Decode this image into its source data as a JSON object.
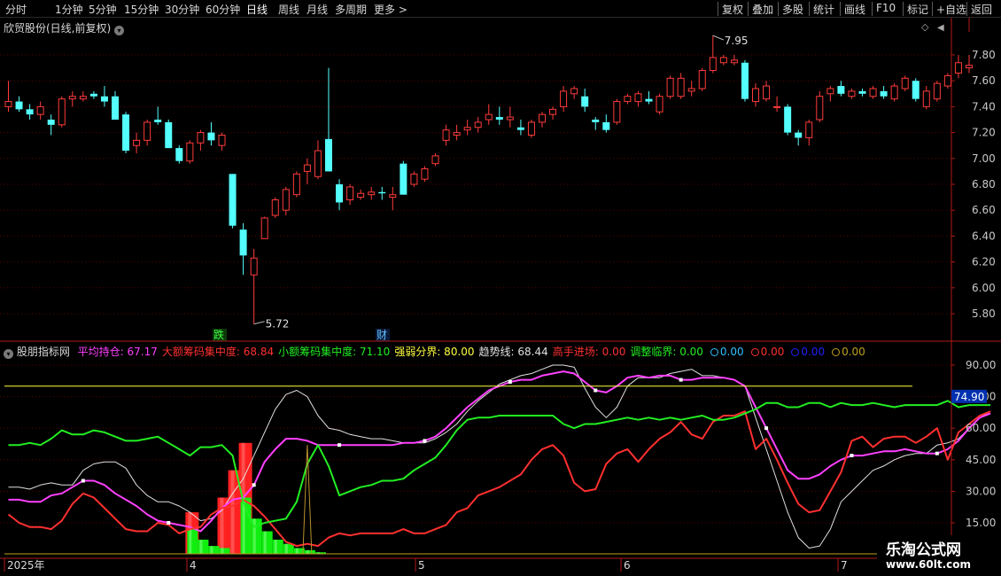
{
  "toolbar": {
    "tabs": [
      "分时",
      "1分钟",
      "5分钟",
      "15分钟",
      "30分钟",
      "60分钟",
      "日线",
      "周线",
      "月线",
      "多周期",
      "更多 >"
    ],
    "active_tab": "日线",
    "right_buttons": [
      "复权",
      "叠加",
      "多股",
      "统计",
      "画线",
      "F10",
      "标记",
      "+自选",
      "返回"
    ]
  },
  "stock_title": "欣贸股份(日线,前复权)",
  "markers": {
    "max_label": "7.95",
    "min_label": "5.72",
    "event_fall": "跌",
    "event_fin": "财"
  },
  "indicator": {
    "name": "股朋指标网",
    "legend": [
      {
        "label": "平均持仓: 67.17",
        "color": "#ff40ff"
      },
      {
        "label": "大额筹码集中度: 68.84",
        "color": "#ff3030"
      },
      {
        "label": "小额筹码集中度: 71.10",
        "color": "#22ee22"
      },
      {
        "label": "强弱分界: 80.00",
        "color": "#ffff40"
      },
      {
        "label": "趋势线: 68.44",
        "color": "#e0e0e0"
      },
      {
        "label": "高手进场: 0.00",
        "color": "#ff3030"
      },
      {
        "label": "调整临界: 0.00",
        "color": "#22ee22"
      },
      {
        "label": "0.00",
        "color": "#30c0ff"
      },
      {
        "label": "0.00",
        "color": "#ff3030"
      },
      {
        "label": "0.00",
        "color": "#2020ff"
      },
      {
        "label": "0.00",
        "color": "#bfa020"
      }
    ],
    "cursor_value": "74.90"
  },
  "price_axis": [
    "7.80",
    "7.60",
    "7.40",
    "7.20",
    "7.00",
    "6.80",
    "6.60",
    "6.40",
    "6.20",
    "6.00",
    "5.80"
  ],
  "ind_axis": [
    "90.00",
    "75.00",
    "60.00",
    "45.00",
    "30.00",
    "15.00"
  ],
  "date_axis": [
    "2025年",
    "4",
    "5",
    "6",
    "7"
  ],
  "watermark": {
    "line1": "乐淘公式网",
    "line2": "www.60lt.com"
  },
  "colors": {
    "up": "#ff3b3b",
    "down": "#54ffff",
    "grid": "#5a0000",
    "axis": "#b01818"
  },
  "chart_data": [
    {
      "type": "candlestick",
      "title": "欣贸股份(日线,前复权)",
      "ylim": [
        5.7,
        7.95
      ],
      "annotations": [
        {
          "x": 47,
          "text": "7.95"
        },
        {
          "x": 19,
          "text": "5.72"
        }
      ],
      "ohlc": [
        [
          7.4,
          7.6,
          7.36,
          7.44
        ],
        [
          7.44,
          7.48,
          7.36,
          7.38
        ],
        [
          7.38,
          7.42,
          7.3,
          7.34
        ],
        [
          7.34,
          7.44,
          7.3,
          7.4
        ],
        [
          7.3,
          7.34,
          7.18,
          7.26
        ],
        [
          7.26,
          7.48,
          7.24,
          7.46
        ],
        [
          7.46,
          7.52,
          7.4,
          7.48
        ],
        [
          7.46,
          7.52,
          7.44,
          7.48
        ],
        [
          7.5,
          7.52,
          7.46,
          7.48
        ],
        [
          7.48,
          7.56,
          7.4,
          7.44
        ],
        [
          7.48,
          7.52,
          7.3,
          7.3
        ],
        [
          7.34,
          7.36,
          7.04,
          7.06
        ],
        [
          7.1,
          7.2,
          7.04,
          7.14
        ],
        [
          7.14,
          7.3,
          7.1,
          7.28
        ],
        [
          7.3,
          7.4,
          7.26,
          7.28
        ],
        [
          7.28,
          7.3,
          7.08,
          7.08
        ],
        [
          7.08,
          7.1,
          6.96,
          6.98
        ],
        [
          6.98,
          7.14,
          6.96,
          7.12
        ],
        [
          7.12,
          7.22,
          7.06,
          7.2
        ],
        [
          7.2,
          7.28,
          7.1,
          7.14
        ],
        [
          7.1,
          7.2,
          7.06,
          7.18
        ],
        [
          6.88,
          6.88,
          6.46,
          6.48
        ],
        [
          6.45,
          6.5,
          6.1,
          6.25
        ],
        [
          6.1,
          6.3,
          5.72,
          6.23
        ],
        [
          6.38,
          6.55,
          6.38,
          6.54
        ],
        [
          6.56,
          6.7,
          6.54,
          6.68
        ],
        [
          6.6,
          6.78,
          6.56,
          6.76
        ],
        [
          6.72,
          6.9,
          6.7,
          6.88
        ],
        [
          6.9,
          7.0,
          6.8,
          6.95
        ],
        [
          6.86,
          7.14,
          6.84,
          7.06
        ],
        [
          7.15,
          7.7,
          6.9,
          6.9
        ],
        [
          6.8,
          6.84,
          6.6,
          6.66
        ],
        [
          6.68,
          6.8,
          6.64,
          6.78
        ],
        [
          6.7,
          6.76,
          6.68,
          6.73
        ],
        [
          6.72,
          6.78,
          6.68,
          6.74
        ],
        [
          6.74,
          6.78,
          6.68,
          6.73
        ],
        [
          6.7,
          6.78,
          6.6,
          6.72
        ],
        [
          6.96,
          6.98,
          6.72,
          6.72
        ],
        [
          6.8,
          6.9,
          6.78,
          6.88
        ],
        [
          6.84,
          6.94,
          6.82,
          6.92
        ],
        [
          6.96,
          7.04,
          6.94,
          7.02
        ],
        [
          7.14,
          7.26,
          7.1,
          7.22
        ],
        [
          7.18,
          7.26,
          7.14,
          7.2
        ],
        [
          7.22,
          7.3,
          7.18,
          7.24
        ],
        [
          7.24,
          7.32,
          7.2,
          7.28
        ],
        [
          7.3,
          7.42,
          7.26,
          7.34
        ],
        [
          7.32,
          7.4,
          7.26,
          7.3
        ],
        [
          7.3,
          7.4,
          7.24,
          7.32
        ],
        [
          7.24,
          7.3,
          7.18,
          7.22
        ],
        [
          7.18,
          7.3,
          7.16,
          7.28
        ],
        [
          7.28,
          7.36,
          7.24,
          7.34
        ],
        [
          7.34,
          7.4,
          7.3,
          7.38
        ],
        [
          7.4,
          7.56,
          7.36,
          7.52
        ],
        [
          7.5,
          7.56,
          7.46,
          7.54
        ],
        [
          7.48,
          7.54,
          7.36,
          7.4
        ],
        [
          7.3,
          7.32,
          7.22,
          7.28
        ],
        [
          7.28,
          7.34,
          7.2,
          7.22
        ],
        [
          7.28,
          7.46,
          7.26,
          7.44
        ],
        [
          7.44,
          7.5,
          7.42,
          7.48
        ],
        [
          7.44,
          7.52,
          7.4,
          7.5
        ],
        [
          7.46,
          7.52,
          7.42,
          7.44
        ],
        [
          7.36,
          7.5,
          7.34,
          7.48
        ],
        [
          7.48,
          7.64,
          7.46,
          7.62
        ],
        [
          7.48,
          7.66,
          7.46,
          7.62
        ],
        [
          7.52,
          7.6,
          7.48,
          7.54
        ],
        [
          7.54,
          7.7,
          7.52,
          7.68
        ],
        [
          7.68,
          7.95,
          7.66,
          7.78
        ],
        [
          7.74,
          7.8,
          7.72,
          7.78
        ],
        [
          7.74,
          7.8,
          7.72,
          7.76
        ],
        [
          7.74,
          7.76,
          7.44,
          7.46
        ],
        [
          7.44,
          7.58,
          7.4,
          7.54
        ],
        [
          7.46,
          7.6,
          7.44,
          7.56
        ],
        [
          7.4,
          7.48,
          7.36,
          7.4
        ],
        [
          7.4,
          7.42,
          7.18,
          7.2
        ],
        [
          7.2,
          7.22,
          7.1,
          7.16
        ],
        [
          7.16,
          7.3,
          7.1,
          7.28
        ],
        [
          7.3,
          7.52,
          7.28,
          7.48
        ],
        [
          7.5,
          7.56,
          7.44,
          7.54
        ],
        [
          7.56,
          7.6,
          7.48,
          7.5
        ],
        [
          7.48,
          7.54,
          7.46,
          7.52
        ],
        [
          7.52,
          7.54,
          7.48,
          7.5
        ],
        [
          7.48,
          7.56,
          7.46,
          7.54
        ],
        [
          7.52,
          7.56,
          7.46,
          7.48
        ],
        [
          7.46,
          7.58,
          7.44,
          7.56
        ],
        [
          7.54,
          7.64,
          7.52,
          7.62
        ],
        [
          7.6,
          7.62,
          7.44,
          7.46
        ],
        [
          7.4,
          7.56,
          7.38,
          7.52
        ],
        [
          7.46,
          7.6,
          7.44,
          7.58
        ],
        [
          7.56,
          7.66,
          7.54,
          7.64
        ],
        [
          7.66,
          7.8,
          7.62,
          7.74
        ],
        [
          7.7,
          7.8,
          7.66,
          7.72
        ]
      ]
    },
    {
      "type": "line",
      "title": "股朋指标网",
      "ylim": [
        0,
        100
      ],
      "series": [
        {
          "name": "趋势线",
          "color": "#e0e0e0",
          "values": [
            32,
            32,
            31,
            33,
            34,
            33,
            33,
            40,
            43,
            44,
            44,
            41,
            33,
            28,
            25,
            25,
            23,
            20,
            16,
            17,
            21,
            29,
            36,
            47,
            58,
            69,
            76,
            78,
            75,
            66,
            60,
            59,
            57,
            56,
            55,
            55,
            54,
            53,
            53,
            53,
            55,
            58,
            62,
            68,
            73,
            77,
            81,
            83,
            85,
            86,
            88,
            90,
            90,
            89,
            79,
            70,
            65,
            70,
            80,
            84,
            84,
            84,
            86,
            87,
            88,
            85,
            85,
            84,
            83,
            80,
            65,
            50,
            35,
            20,
            8,
            3,
            4,
            12,
            25,
            30,
            35,
            40,
            42,
            45,
            47,
            48,
            48,
            52,
            53,
            55,
            60,
            65,
            68
          ]
        },
        {
          "name": "平均持仓",
          "color": "#ff40ff",
          "values": [
            26,
            26,
            25,
            25,
            28,
            29,
            32,
            35,
            35,
            33,
            29,
            26,
            23,
            19,
            16,
            15,
            14,
            13,
            11,
            16,
            22,
            26,
            27,
            33,
            44,
            50,
            55,
            55,
            54,
            52,
            52,
            52,
            52,
            52,
            52,
            52,
            52,
            53,
            53,
            54,
            56,
            60,
            65,
            70,
            74,
            78,
            80,
            82,
            83,
            83,
            85,
            86,
            87,
            86,
            82,
            78,
            77,
            80,
            84,
            85,
            84,
            85,
            85,
            83,
            83,
            84,
            84,
            84,
            83,
            80,
            70,
            60,
            50,
            40,
            36,
            36,
            38,
            42,
            45,
            47,
            47,
            48,
            49,
            49,
            50,
            49,
            48,
            48,
            50,
            54,
            60,
            65,
            67
          ]
        },
        {
          "name": "大额筹码集中度",
          "color": "#ff3030",
          "values": [
            19,
            15,
            13,
            13,
            12,
            16,
            24,
            29,
            27,
            22,
            17,
            12,
            11,
            11,
            15,
            14,
            10,
            12,
            13,
            19,
            22,
            23,
            26,
            23,
            18,
            12,
            6,
            4,
            5,
            4,
            8,
            10,
            9,
            10,
            10,
            10,
            10,
            12,
            10,
            10,
            12,
            14,
            20,
            22,
            28,
            30,
            32,
            35,
            38,
            45,
            50,
            52,
            47,
            34,
            30,
            31,
            43,
            48,
            50,
            44,
            50,
            55,
            58,
            63,
            57,
            55,
            63,
            66,
            66,
            68,
            50,
            55,
            45,
            34,
            24,
            20,
            21,
            30,
            39,
            54,
            56,
            51,
            55,
            56,
            56,
            53,
            56,
            60,
            45,
            58,
            62,
            66,
            68
          ]
        },
        {
          "name": "小额筹码集中度",
          "color": "#22ee22",
          "values": [
            52,
            52,
            53,
            52,
            55,
            59,
            57,
            57,
            59,
            58,
            56,
            54,
            54,
            55,
            56,
            53,
            50,
            47,
            51,
            51,
            52,
            47,
            25,
            13,
            15,
            16,
            17,
            25,
            43,
            52,
            42,
            28,
            30,
            32,
            33,
            35,
            35,
            36,
            40,
            43,
            46,
            52,
            59,
            64,
            65,
            65,
            66,
            66,
            66,
            66,
            66,
            66,
            62,
            60,
            62,
            62,
            63,
            64,
            65,
            64,
            65,
            64,
            65,
            64,
            65,
            66,
            64,
            64,
            65,
            67,
            69,
            72,
            72,
            70,
            70,
            72,
            72,
            70,
            72,
            71,
            71,
            72,
            71,
            70,
            71,
            71,
            71,
            71,
            73,
            70,
            71,
            71,
            71
          ]
        },
        {
          "name": "强弱分界",
          "color": "#ffff40",
          "values": [
            80
          ]
        }
      ],
      "bars": {
        "red": [
          [
            17,
            20
          ],
          [
            20,
            27
          ],
          [
            21,
            40
          ],
          [
            22,
            53
          ]
        ],
        "green": [
          [
            17,
            12
          ],
          [
            18,
            7
          ],
          [
            19,
            4
          ],
          [
            20,
            3
          ],
          [
            22,
            27
          ],
          [
            23,
            17
          ],
          [
            24,
            11
          ],
          [
            25,
            7
          ],
          [
            26,
            5
          ],
          [
            27,
            3
          ],
          [
            28,
            2
          ],
          [
            29,
            1
          ]
        ]
      }
    }
  ]
}
